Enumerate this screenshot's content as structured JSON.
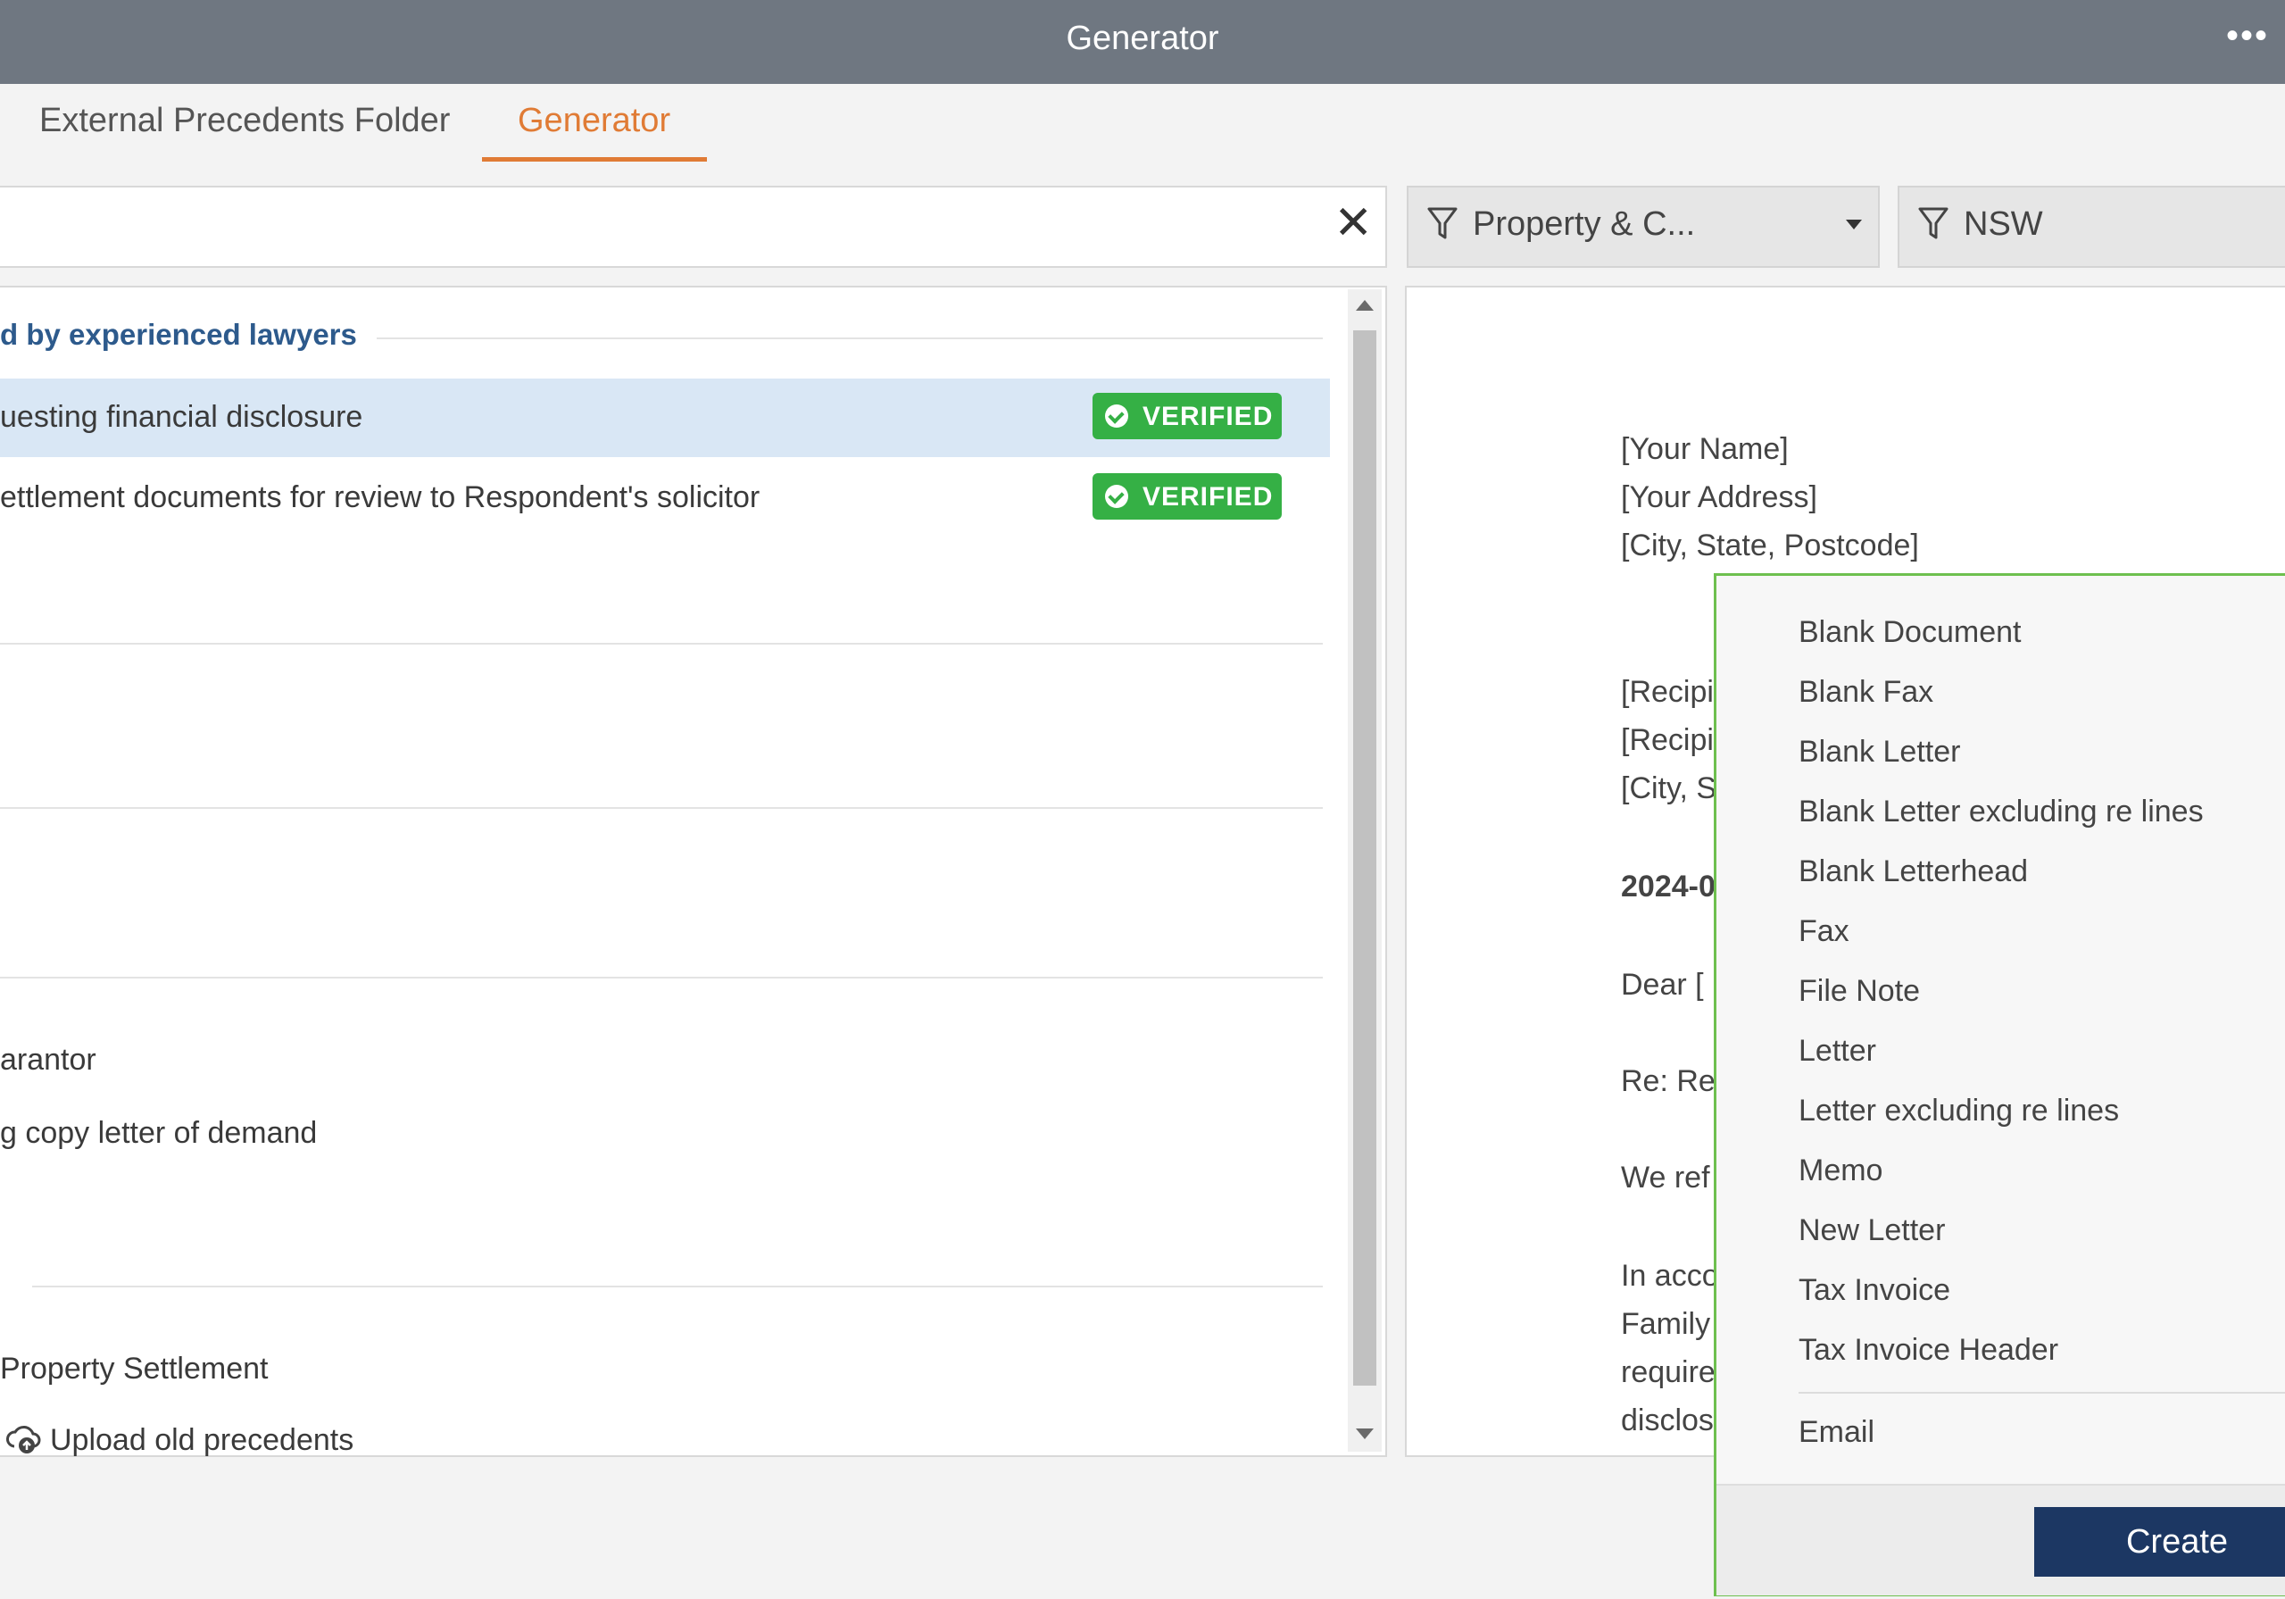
{
  "window": {
    "title": "Generator",
    "more_icon": "more-horizontal-icon"
  },
  "tabs": [
    {
      "label": "External Precedents Folder",
      "active": false
    },
    {
      "label": "Generator",
      "active": true
    }
  ],
  "search": {
    "value": "",
    "clear_icon": "close-icon"
  },
  "filters": [
    {
      "label": "Property & C...",
      "icon": "filter-icon",
      "has_dropdown": true
    },
    {
      "label": "NSW",
      "icon": "filter-icon",
      "has_dropdown": false
    }
  ],
  "list": {
    "section_header": "d by experienced lawyers",
    "items": [
      {
        "label": "uesting financial disclosure",
        "badge": "VERIFIED",
        "selected": true
      },
      {
        "label": "ettlement documents for review to Respondent's solicitor",
        "badge": "VERIFIED",
        "selected": false
      },
      {
        "label": "arantor"
      },
      {
        "label": "g copy letter of demand"
      },
      {
        "label": "Property Settlement"
      }
    ],
    "upload": {
      "label": "Upload old precedents",
      "icon": "cloud-upload-icon"
    }
  },
  "preview": {
    "lines": [
      "[Your Name]",
      "[Your Address]",
      "[City, State, Postcode]",
      "[Recipi",
      "[Recipi",
      "[City, S",
      "2024-0",
      "Dear [",
      "Re: Re",
      "We ref",
      "In acco",
      "Family",
      "require",
      "disclos"
    ]
  },
  "dropdown": {
    "items": [
      "Blank Document",
      "Blank Fax",
      "Blank Letter",
      "Blank Letter excluding re lines",
      "Blank Letterhead",
      "Fax",
      "File Note",
      "Letter",
      "Letter excluding re lines",
      "Memo",
      "New Letter",
      "Tax Invoice",
      "Tax Invoice Header"
    ],
    "extra_item": "Email",
    "create_label": "Create"
  },
  "colors": {
    "titlebar": "#6f7781",
    "accent_tab": "#e07b35",
    "verified_badge": "#35b045",
    "selected_row": "#d9e7f5",
    "section_header": "#2d5a8c",
    "dropdown_border": "#6ec04f",
    "create_button": "#1c3763"
  }
}
